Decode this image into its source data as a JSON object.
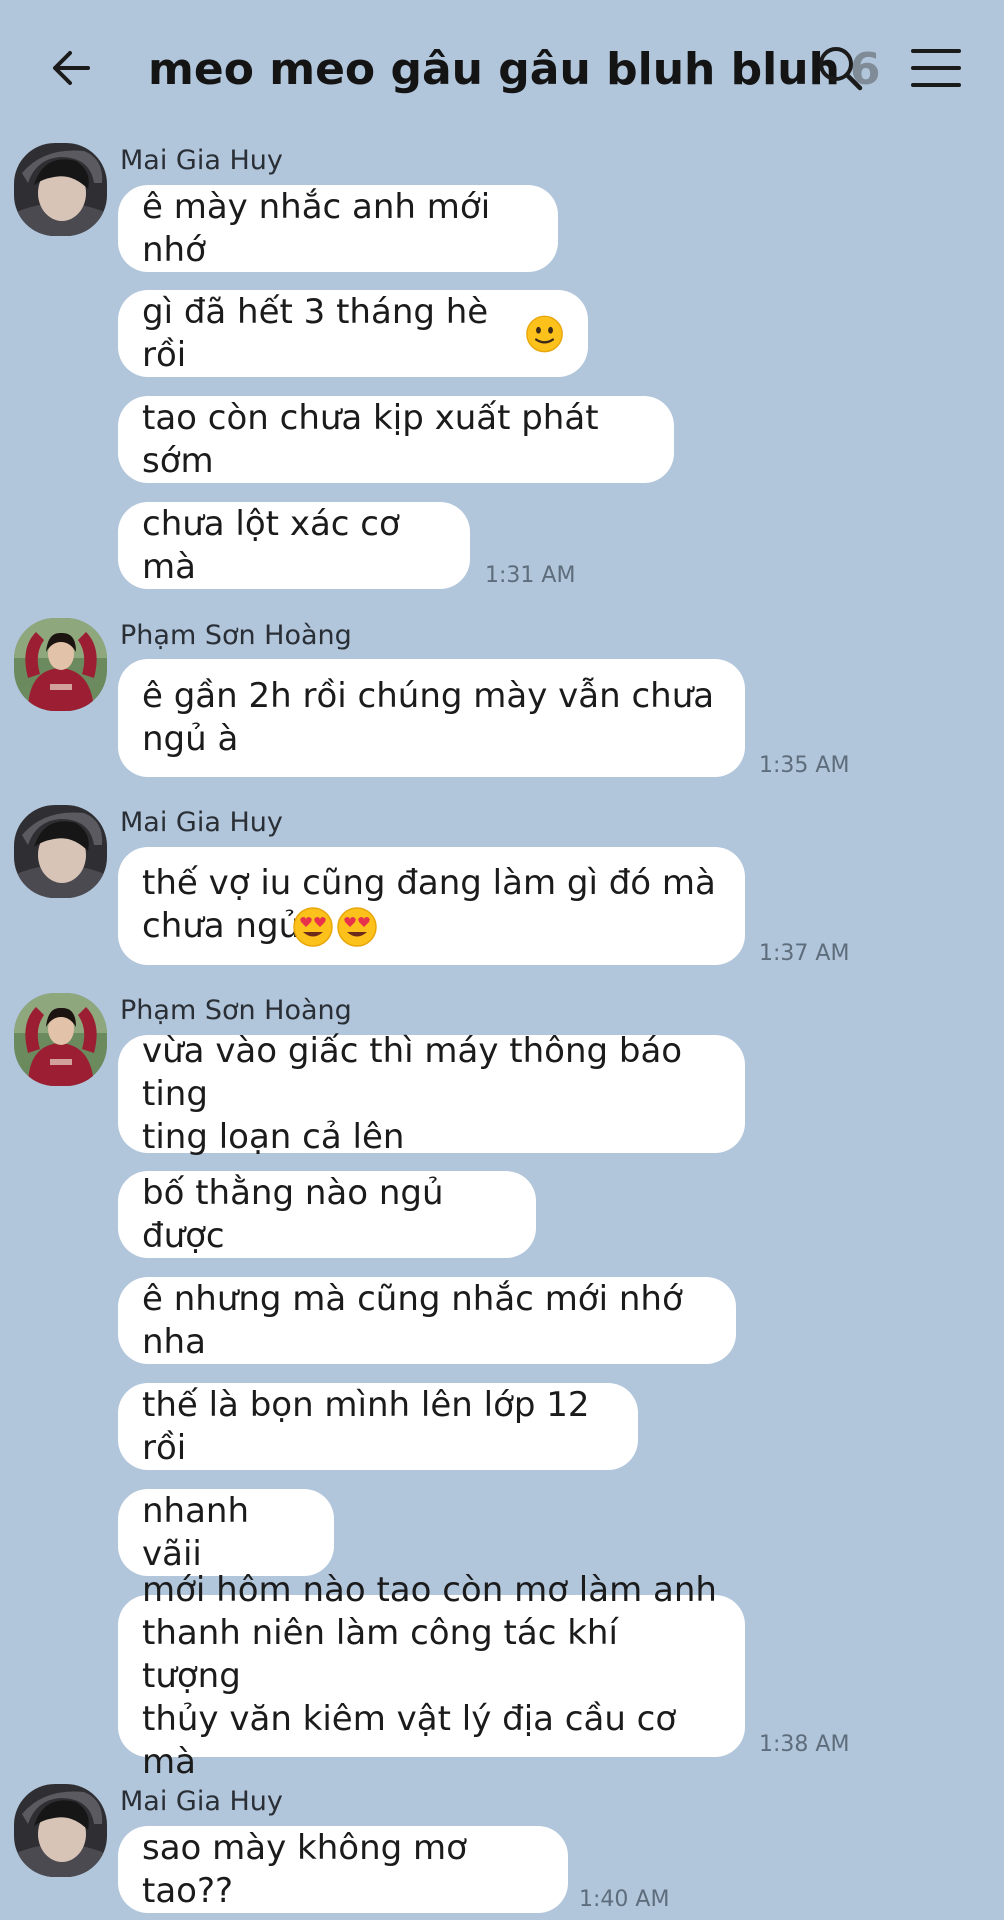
{
  "header": {
    "title": "meo meo gâu gâu bluh bluh",
    "member_count": "6",
    "back_icon": "arrow-left-icon",
    "search_icon": "search-icon",
    "menu_icon": "hamburger-menu-icon"
  },
  "messages": [
    {
      "sender": "Mai Gia Huy",
      "text": "ê mày nhắc anh mới nhớ"
    },
    {
      "text": "gì đã hết 3 tháng hè rồi"
    },
    {
      "text": "tao còn chưa kịp xuất phát sớm"
    },
    {
      "text": "chưa lột xác cơ mà",
      "time": "1:31 AM"
    },
    {
      "sender": "Phạm Sơn Hoàng",
      "text": "ê gần 2h rồi chúng mày vẫn chưa\nngủ à",
      "time": "1:35 AM"
    },
    {
      "sender": "Mai Gia Huy",
      "text": "thế vợ iu cũng đang làm gì đó mà\nchưa ngủ",
      "time": "1:37 AM"
    },
    {
      "sender": "Phạm Sơn Hoàng",
      "text": "vừa vào giấc thì máy thông báo ting\nting loạn cả lên"
    },
    {
      "text": "bố thằng nào ngủ được"
    },
    {
      "text": "ê nhưng mà cũng nhắc mới nhớ nha"
    },
    {
      "text": "thế là bọn mình lên lớp 12 rồi"
    },
    {
      "text": "nhanh vãii"
    },
    {
      "text": "mới hôm nào tao còn mơ làm anh\nthanh niên làm công tác khí tượng\nthủy văn kiêm vật lý địa cầu cơ mà",
      "time": "1:38 AM"
    },
    {
      "sender": "Mai Gia Huy",
      "text": "sao mày không mơ tao??",
      "time": "1:40 AM"
    }
  ],
  "emoji_names": {
    "m1": "slightly-smiling-face-emoji",
    "m5": "heart-eyes-emoji"
  },
  "colors": {
    "background": "#b1c5db",
    "bubble": "#ffffff",
    "timestamp": "#5e6d7c",
    "member_count": "#7f8b96"
  }
}
